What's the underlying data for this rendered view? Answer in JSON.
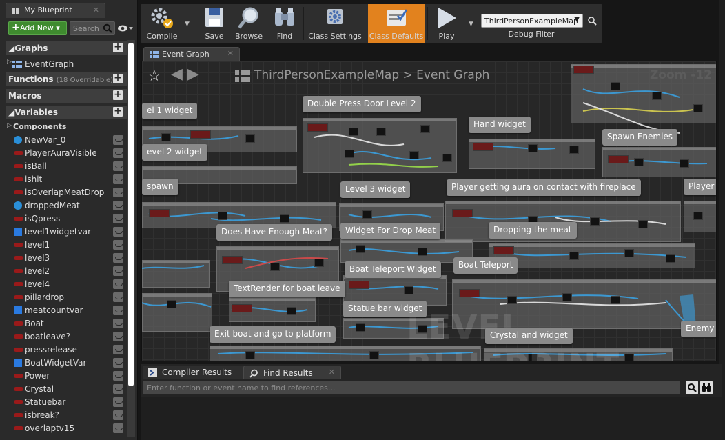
{
  "left_panel": {
    "tab_title": "My Blueprint",
    "add_new_label": "Add New",
    "search_placeholder": "Search",
    "sections": {
      "graphs": "Graphs",
      "functions": "Functions",
      "functions_sub": "(18 Overridable)",
      "macros": "Macros",
      "variables": "Variables"
    },
    "graph_items": [
      "EventGraph"
    ],
    "components_label": "Components",
    "variables": [
      {
        "name": "NewVar_0",
        "type": "dot"
      },
      {
        "name": "PlayerAuraVisible",
        "type": "pill"
      },
      {
        "name": "isBall",
        "type": "pill"
      },
      {
        "name": "ishit",
        "type": "pill"
      },
      {
        "name": "isOverlapMeatDrop",
        "type": "pill"
      },
      {
        "name": "droppedMeat",
        "type": "dot"
      },
      {
        "name": "isQpress",
        "type": "pill"
      },
      {
        "name": "level1widgetvar",
        "type": "sq"
      },
      {
        "name": "level1",
        "type": "pill"
      },
      {
        "name": "level3",
        "type": "pill"
      },
      {
        "name": "level2",
        "type": "pill"
      },
      {
        "name": "level4",
        "type": "pill"
      },
      {
        "name": "pillardrop",
        "type": "pill"
      },
      {
        "name": "meatcountvar",
        "type": "sq"
      },
      {
        "name": "Boat",
        "type": "pill"
      },
      {
        "name": "boatleave?",
        "type": "pill"
      },
      {
        "name": "pressrelease",
        "type": "pill"
      },
      {
        "name": "BoatWidgetVar",
        "type": "sq"
      },
      {
        "name": "Power",
        "type": "pill"
      },
      {
        "name": "Crystal",
        "type": "pill"
      },
      {
        "name": "Statuebar",
        "type": "pill"
      },
      {
        "name": "isbreak?",
        "type": "pill"
      },
      {
        "name": "overlaptv15",
        "type": "pill"
      }
    ]
  },
  "toolbar": {
    "compile": "Compile",
    "save": "Save",
    "browse": "Browse",
    "find": "Find",
    "class_settings": "Class Settings",
    "class_defaults": "Class Defaults",
    "play": "Play",
    "debug_select": "ThirdPersonExampleMap",
    "debug_filter": "Debug Filter"
  },
  "graph": {
    "tab_title": "Event Graph",
    "breadcrumb": "ThirdPersonExampleMap > Event Graph",
    "zoom": "Zoom -12",
    "watermark": "LEVEL BLUEPRINT",
    "comments": [
      "el 1 widget",
      "Double Press Door Level 2",
      "Hand widget",
      "Spawn Enemies",
      "evel 2 widget",
      "spawn",
      "Level 3 widget",
      "Player getting aura on contact with fireplace",
      "Player",
      "Does Have Enough Meat?",
      "Widget For Drop Meat",
      "Dropping the meat",
      "Boat Teleport Widget",
      "Boat Teleport",
      "TextRender for boat leave",
      "Statue bar widget",
      "Exit boat and go to platform",
      "Crystal and widget",
      "Enemy S"
    ]
  },
  "bottom": {
    "compiler_results": "Compiler Results",
    "find_results": "Find Results",
    "find_placeholder": "Enter function or event name to find references..."
  },
  "colors": {
    "accent_orange": "#e2821e",
    "add_green": "#3f8b2f",
    "bool_red": "#9a1a1a",
    "var_blue": "#2a8fd8"
  }
}
